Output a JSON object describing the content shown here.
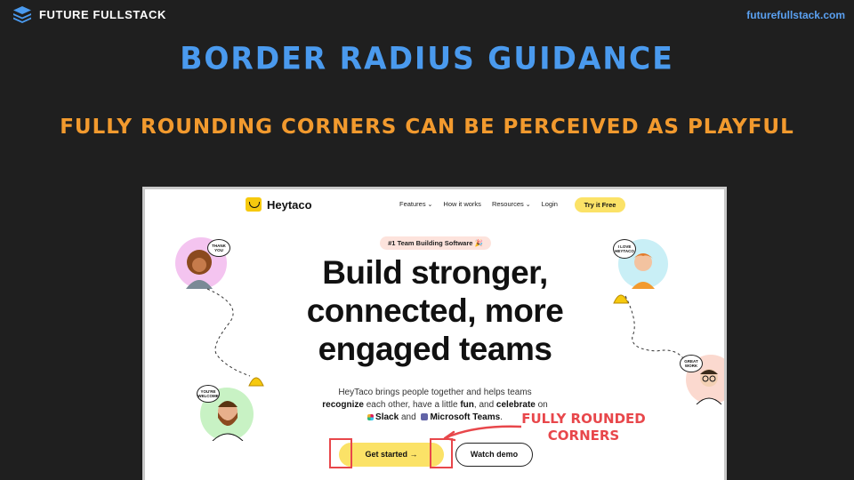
{
  "brand": {
    "name": "FUTURE FULLSTACK",
    "url": "futurefullstack.com"
  },
  "title": "Border Radius Guidance",
  "subtitle": "Fully Rounding Corners Can Be Perceived As Playful",
  "screenshot": {
    "logo": "Heytaco",
    "nav": [
      "Features",
      "How it works",
      "Resources",
      "Login"
    ],
    "cta_nav": "Try it Free",
    "badge": "#1 Team Building Software 🎉",
    "headline_lines": [
      "Build stronger,",
      "connected, more",
      "engaged teams"
    ],
    "description": {
      "line1": "HeyTaco brings people together and helps teams",
      "recognize": "recognize",
      "line2_mid": " each other, have a little ",
      "fun": "fun",
      "line2_and": ", and ",
      "celebrate": "celebrate",
      "line2_end": " on",
      "slack": "Slack",
      "and": " and ",
      "teams": "Microsoft Teams",
      "period": "."
    },
    "primary_button": "Get started →",
    "secondary_button": "Watch demo",
    "bubbles": {
      "thank_you": "THANK YOU",
      "youre_welcome": "YOU'RE WELCOME",
      "i_love_heytaco": "I LOVE HEYTACO",
      "great_work": "GREAT WORK"
    }
  },
  "annotation": {
    "line1": "FULLY ROUNDED",
    "line2": "CORNERS",
    "color": "#e8474b"
  },
  "colors": {
    "background": "#1f1f1f",
    "title": "#4a9aee",
    "subtitle": "#f29a2e",
    "accent_yellow": "#fbe267"
  }
}
